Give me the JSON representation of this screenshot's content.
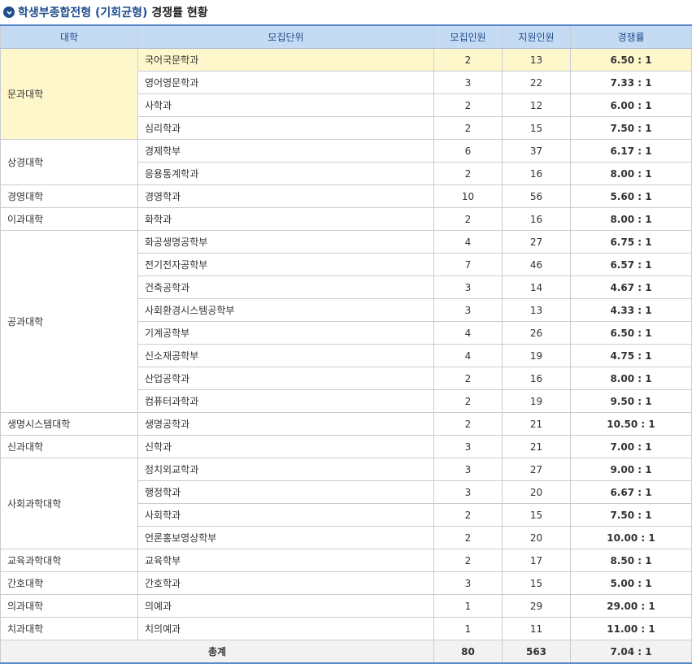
{
  "title": {
    "main": "학생부종합전형 (기회균형)",
    "rest": "경쟁률 현황",
    "icon": "chevron-down-circle-icon"
  },
  "colors": {
    "header_bg": "#c5daf3",
    "highlight_bg": "#fff7cc",
    "accent": "#1f4e8c"
  },
  "table": {
    "headers": {
      "college": "대학",
      "unit": "모집단위",
      "recruit": "모집인원",
      "applicants": "지원인원",
      "rate": "경쟁률"
    },
    "groups": [
      {
        "college": "문과대학",
        "highlighted": true,
        "rows": [
          {
            "unit": "국어국문학과",
            "recruit": "2",
            "applicants": "13",
            "rate": "6.50 : 1",
            "highlighted": true
          },
          {
            "unit": "영어영문학과",
            "recruit": "3",
            "applicants": "22",
            "rate": "7.33 : 1"
          },
          {
            "unit": "사학과",
            "recruit": "2",
            "applicants": "12",
            "rate": "6.00 : 1"
          },
          {
            "unit": "심리학과",
            "recruit": "2",
            "applicants": "15",
            "rate": "7.50 : 1"
          }
        ]
      },
      {
        "college": "상경대학",
        "rows": [
          {
            "unit": "경제학부",
            "recruit": "6",
            "applicants": "37",
            "rate": "6.17 : 1"
          },
          {
            "unit": "응용통계학과",
            "recruit": "2",
            "applicants": "16",
            "rate": "8.00 : 1"
          }
        ]
      },
      {
        "college": "경영대학",
        "rows": [
          {
            "unit": "경영학과",
            "recruit": "10",
            "applicants": "56",
            "rate": "5.60 : 1"
          }
        ]
      },
      {
        "college": "이과대학",
        "rows": [
          {
            "unit": "화학과",
            "recruit": "2",
            "applicants": "16",
            "rate": "8.00 : 1"
          }
        ]
      },
      {
        "college": "공과대학",
        "rows": [
          {
            "unit": "화공생명공학부",
            "recruit": "4",
            "applicants": "27",
            "rate": "6.75 : 1"
          },
          {
            "unit": "전기전자공학부",
            "recruit": "7",
            "applicants": "46",
            "rate": "6.57 : 1"
          },
          {
            "unit": "건축공학과",
            "recruit": "3",
            "applicants": "14",
            "rate": "4.67 : 1"
          },
          {
            "unit": "사회환경시스템공학부",
            "recruit": "3",
            "applicants": "13",
            "rate": "4.33 : 1"
          },
          {
            "unit": "기계공학부",
            "recruit": "4",
            "applicants": "26",
            "rate": "6.50 : 1"
          },
          {
            "unit": "신소재공학부",
            "recruit": "4",
            "applicants": "19",
            "rate": "4.75 : 1"
          },
          {
            "unit": "산업공학과",
            "recruit": "2",
            "applicants": "16",
            "rate": "8.00 : 1"
          },
          {
            "unit": "컴퓨터과학과",
            "recruit": "2",
            "applicants": "19",
            "rate": "9.50 : 1"
          }
        ]
      },
      {
        "college": "생명시스템대학",
        "rows": [
          {
            "unit": "생명공학과",
            "recruit": "2",
            "applicants": "21",
            "rate": "10.50 : 1"
          }
        ]
      },
      {
        "college": "신과대학",
        "rows": [
          {
            "unit": "신학과",
            "recruit": "3",
            "applicants": "21",
            "rate": "7.00 : 1"
          }
        ]
      },
      {
        "college": "사회과학대학",
        "rows": [
          {
            "unit": "정치외교학과",
            "recruit": "3",
            "applicants": "27",
            "rate": "9.00 : 1"
          },
          {
            "unit": "행정학과",
            "recruit": "3",
            "applicants": "20",
            "rate": "6.67 : 1"
          },
          {
            "unit": "사회학과",
            "recruit": "2",
            "applicants": "15",
            "rate": "7.50 : 1"
          },
          {
            "unit": "언론홍보영상학부",
            "recruit": "2",
            "applicants": "20",
            "rate": "10.00 : 1"
          }
        ]
      },
      {
        "college": "교육과학대학",
        "rows": [
          {
            "unit": "교육학부",
            "recruit": "2",
            "applicants": "17",
            "rate": "8.50 : 1"
          }
        ]
      },
      {
        "college": "간호대학",
        "rows": [
          {
            "unit": "간호학과",
            "recruit": "3",
            "applicants": "15",
            "rate": "5.00 : 1"
          }
        ]
      },
      {
        "college": "의과대학",
        "rows": [
          {
            "unit": "의예과",
            "recruit": "1",
            "applicants": "29",
            "rate": "29.00 : 1"
          }
        ]
      },
      {
        "college": "치과대학",
        "rows": [
          {
            "unit": "치의예과",
            "recruit": "1",
            "applicants": "11",
            "rate": "11.00 : 1"
          }
        ]
      }
    ],
    "total": {
      "label": "총계",
      "recruit": "80",
      "applicants": "563",
      "rate": "7.04 : 1"
    }
  }
}
